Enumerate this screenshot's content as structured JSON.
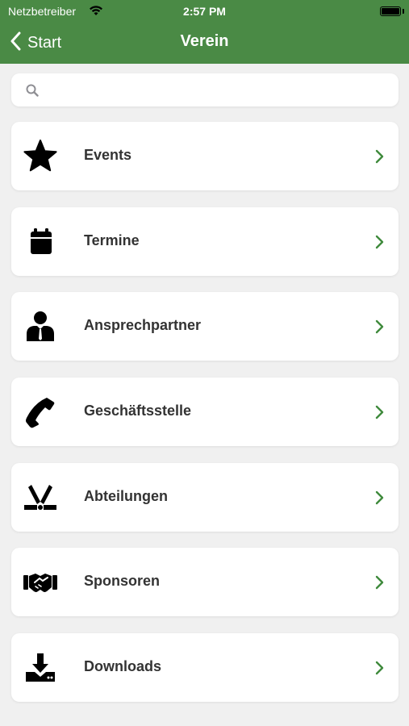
{
  "status_bar": {
    "carrier": "Netzbetreiber",
    "time": "2:57 PM"
  },
  "nav": {
    "back_label": "Start",
    "title": "Verein"
  },
  "search": {
    "value": "",
    "placeholder": ""
  },
  "colors": {
    "brand_green": "#4a8a45",
    "chevron_green": "#3f8a3c",
    "background": "#f0f0f0"
  },
  "menu": {
    "items": [
      {
        "label": "Events",
        "icon": "star-icon"
      },
      {
        "label": "Termine",
        "icon": "calendar-icon"
      },
      {
        "label": "Ansprechpartner",
        "icon": "person-icon"
      },
      {
        "label": "Geschäftsstelle",
        "icon": "phone-icon"
      },
      {
        "label": "Abteilungen",
        "icon": "hockey-sticks-icon"
      },
      {
        "label": "Sponsoren",
        "icon": "handshake-icon"
      },
      {
        "label": "Downloads",
        "icon": "download-icon"
      }
    ]
  }
}
